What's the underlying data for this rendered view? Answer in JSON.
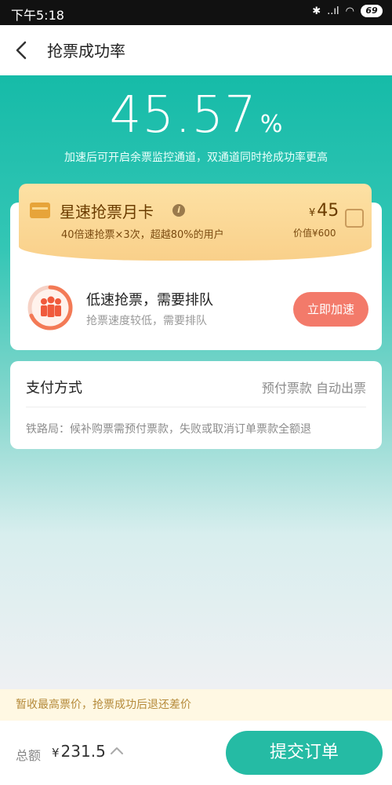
{
  "status_bar": {
    "time": "下午5:18",
    "signal": "..ıl",
    "battery": "69"
  },
  "app_bar": {
    "title": "抢票成功率"
  },
  "hero": {
    "rate": "45.57",
    "unit": "%",
    "description": "加速后可开启余票监控通道，双通道同时抢成功率更高"
  },
  "vip_card": {
    "title": "星速抢票月卡",
    "description": "40倍速抢票×3次，超越80%的用户",
    "price_symbol": "¥",
    "price": "45",
    "original": "价值¥600",
    "checked": false
  },
  "low_speed": {
    "title": "低速抢票，需要排队",
    "description": "抢票速度较低，需要排队",
    "button": "立即加速"
  },
  "payment": {
    "title": "支付方式",
    "method": "预付票款 自动出票",
    "note": "铁路局：候补购票需预付票款，失败或取消订单票款全额退"
  },
  "notice": {
    "text": "暂收最高票价，抢票成功后退还差价"
  },
  "footer": {
    "total_label": "总额",
    "currency": "¥",
    "total": "231.5",
    "submit": "提交订单"
  },
  "colors": {
    "accent": "#25bba4",
    "speed_button": "#f37a6a",
    "vip_gold": "#fde1a4"
  }
}
